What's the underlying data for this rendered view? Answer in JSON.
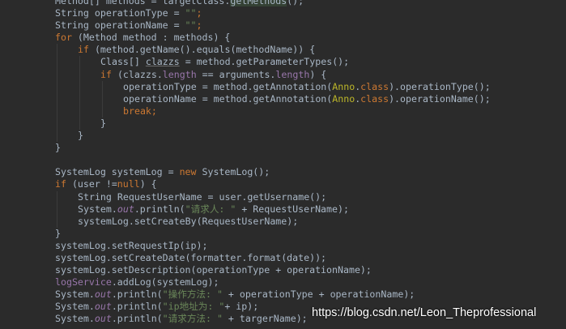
{
  "lines": [
    {
      "indent": 0,
      "tokens": [
        [
          "plain",
          "Method[] methods = targetClass."
        ],
        [
          "hl",
          "getMethods"
        ],
        [
          "plain",
          "();"
        ]
      ]
    },
    {
      "indent": 0,
      "tokens": [
        [
          "plain",
          "String operationType = "
        ],
        [
          "str",
          "\"\""
        ],
        [
          "kw",
          ";"
        ]
      ]
    },
    {
      "indent": 0,
      "tokens": [
        [
          "plain",
          "String operationName = "
        ],
        [
          "str",
          "\"\""
        ],
        [
          "kw",
          ";"
        ]
      ]
    },
    {
      "indent": 0,
      "tokens": [
        [
          "kw",
          "for "
        ],
        [
          "plain",
          "(Method method : methods) {"
        ]
      ]
    },
    {
      "indent": 1,
      "tokens": [
        [
          "kw",
          "if "
        ],
        [
          "plain",
          "(method.getName().equals(methodName)) {"
        ]
      ]
    },
    {
      "indent": 2,
      "tokens": [
        [
          "plain",
          "Class[] "
        ],
        [
          "und",
          "clazzs"
        ],
        [
          "plain",
          " = method.getParameterTypes();"
        ]
      ]
    },
    {
      "indent": 2,
      "tokens": [
        [
          "kw",
          "if "
        ],
        [
          "plain",
          "(clazzs."
        ],
        [
          "fld",
          "length"
        ],
        [
          "plain",
          " == arguments."
        ],
        [
          "fld",
          "length"
        ],
        [
          "plain",
          ") {"
        ]
      ]
    },
    {
      "indent": 3,
      "tokens": [
        [
          "plain",
          "operationType = method.getAnnotation("
        ],
        [
          "ann",
          "Anno"
        ],
        [
          "plain",
          "."
        ],
        [
          "kw",
          "class"
        ],
        [
          "plain",
          ").operationType();"
        ]
      ]
    },
    {
      "indent": 3,
      "tokens": [
        [
          "plain",
          "operationName = method.getAnnotation("
        ],
        [
          "ann",
          "Anno"
        ],
        [
          "plain",
          "."
        ],
        [
          "kw",
          "class"
        ],
        [
          "plain",
          ").operationName();"
        ]
      ]
    },
    {
      "indent": 3,
      "tokens": [
        [
          "kw",
          "break;"
        ]
      ]
    },
    {
      "indent": 2,
      "tokens": [
        [
          "plain",
          "}"
        ]
      ]
    },
    {
      "indent": 1,
      "tokens": [
        [
          "plain",
          "}"
        ]
      ]
    },
    {
      "indent": 0,
      "tokens": [
        [
          "plain",
          "}"
        ]
      ]
    },
    {
      "indent": 0,
      "tokens": []
    },
    {
      "indent": 0,
      "tokens": [
        [
          "plain",
          "SystemLog systemLog = "
        ],
        [
          "kw",
          "new "
        ],
        [
          "plain",
          "SystemLog();"
        ]
      ]
    },
    {
      "indent": 0,
      "tokens": [
        [
          "kw",
          "if "
        ],
        [
          "plain",
          "(user !="
        ],
        [
          "kw",
          "null"
        ],
        [
          "plain",
          ") {"
        ]
      ]
    },
    {
      "indent": 1,
      "tokens": [
        [
          "plain",
          "String RequestUserName = user.getUsername();"
        ]
      ]
    },
    {
      "indent": 1,
      "tokens": [
        [
          "plain",
          "System."
        ],
        [
          "sfld",
          "out"
        ],
        [
          "plain",
          ".println("
        ],
        [
          "str",
          "\"请求人: \""
        ],
        [
          "plain",
          " + RequestUserName);"
        ]
      ]
    },
    {
      "indent": 1,
      "tokens": [
        [
          "plain",
          "systemLog.setCreateBy(RequestUserName);"
        ]
      ]
    },
    {
      "indent": 0,
      "tokens": [
        [
          "plain",
          "}"
        ]
      ]
    },
    {
      "indent": 0,
      "tokens": [
        [
          "plain",
          "systemLog.setRequestIp(ip);"
        ]
      ]
    },
    {
      "indent": 0,
      "tokens": [
        [
          "plain",
          "systemLog.setCreateDate(formatter.format(date));"
        ]
      ]
    },
    {
      "indent": 0,
      "tokens": [
        [
          "plain",
          "systemLog.setDescription(operationType + operationName);"
        ]
      ]
    },
    {
      "indent": 0,
      "tokens": [
        [
          "fld",
          "logService"
        ],
        [
          "plain",
          ".addLog(systemLog);"
        ]
      ]
    },
    {
      "indent": 0,
      "tokens": [
        [
          "plain",
          "System."
        ],
        [
          "sfld",
          "out"
        ],
        [
          "plain",
          ".println("
        ],
        [
          "str",
          "\"操作方法: \""
        ],
        [
          "plain",
          " + operationType + operationName);"
        ]
      ]
    },
    {
      "indent": 0,
      "tokens": [
        [
          "plain",
          "System."
        ],
        [
          "sfld",
          "out"
        ],
        [
          "plain",
          ".println("
        ],
        [
          "str",
          "\"ip地址为: \""
        ],
        [
          "plain",
          "+ ip);"
        ]
      ]
    },
    {
      "indent": 0,
      "tokens": [
        [
          "plain",
          "System."
        ],
        [
          "sfld",
          "out"
        ],
        [
          "plain",
          ".println("
        ],
        [
          "str",
          "\"请求方法: \""
        ],
        [
          "plain",
          " + targerName);"
        ]
      ]
    }
  ],
  "watermark": "https://blog.csdn.net/Leon_Theprofessional",
  "colors": {
    "background": "#2b2b2b",
    "text": "#a9b7c6",
    "keyword": "#cc7832",
    "string": "#6a8759",
    "field": "#9876aa",
    "annotation": "#bbb529"
  }
}
